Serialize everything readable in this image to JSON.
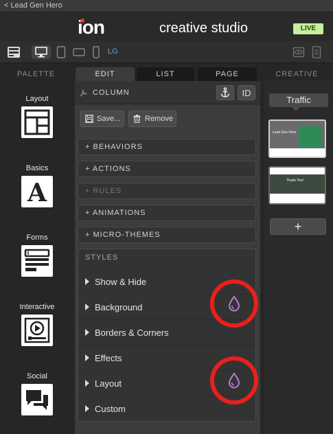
{
  "topbar": {
    "back_label": "< Lead Gen Hero"
  },
  "header": {
    "logo_text": "ion",
    "title": "creative studio",
    "status_badge": "LIVE"
  },
  "toolbar": {
    "device_label": "LG",
    "icons": [
      "layout-toggle-icon",
      "desktop-icon",
      "tablet-icon",
      "tablet-landscape-icon",
      "phone-icon",
      "preview-eye-icon",
      "document-icon"
    ]
  },
  "tabs": [
    {
      "label": "PALETTE"
    },
    {
      "label": "EDIT"
    },
    {
      "label": "LIST"
    },
    {
      "label": "PAGE"
    },
    {
      "label": "CREATIVE"
    }
  ],
  "palette": [
    {
      "label": "Layout",
      "icon": "layout-icon"
    },
    {
      "label": "Basics",
      "icon": "text-a-icon"
    },
    {
      "label": "Forms",
      "icon": "form-icon"
    },
    {
      "label": "Interactive",
      "icon": "video-icon"
    },
    {
      "label": "Social",
      "icon": "chat-icon"
    }
  ],
  "edit": {
    "title": "COLUMN",
    "id_button": "ID",
    "save_label": "Save...",
    "remove_label": "Remove",
    "sections": [
      {
        "label": "+ BEHAVIORS",
        "disabled": false
      },
      {
        "label": "+ ACTIONS",
        "disabled": false
      },
      {
        "label": "+ RULES",
        "disabled": true
      },
      {
        "label": "+ ANIMATIONS",
        "disabled": false
      },
      {
        "label": "+ MICRO-THEMES",
        "disabled": false
      }
    ],
    "styles_heading": "STYLES",
    "style_rows": [
      {
        "label": "Show & Hide"
      },
      {
        "label": "Background"
      },
      {
        "label": "Borders & Corners"
      },
      {
        "label": "Effects"
      },
      {
        "label": "Layout"
      },
      {
        "label": "Custom"
      }
    ]
  },
  "creative": {
    "traffic_label": "Traffic",
    "thumbnail_1_text": "Lead Gen Hero",
    "thumbnail_2_text": "Thank You!",
    "add_label": "+"
  },
  "colors": {
    "accent_red": "#e8201e",
    "live_green": "#c6ef9c",
    "droplet_purple": "#b57bd4",
    "link_blue": "#5ea3d8"
  }
}
